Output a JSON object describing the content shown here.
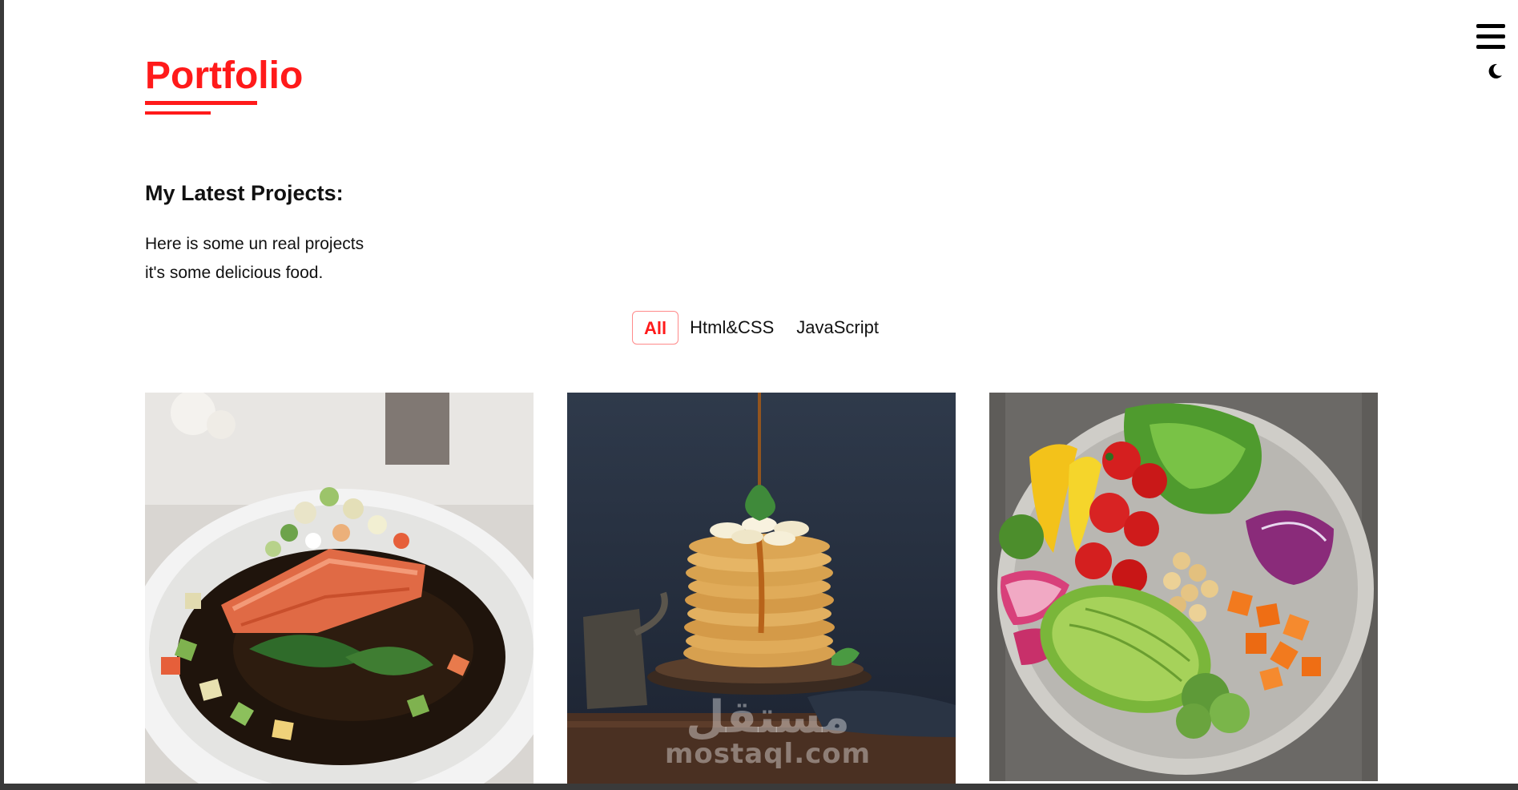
{
  "header": {
    "menu_icon": "hamburger-menu-icon",
    "theme_icon": "moon-icon"
  },
  "portfolio": {
    "title": "Portfolio",
    "subtitle": "My Latest Projects:",
    "description_line1": "Here is some un real projects",
    "description_line2": "it's some delicious food."
  },
  "filters": [
    {
      "label": "All",
      "active": true
    },
    {
      "label": "Html&CSS",
      "active": false
    },
    {
      "label": "JavaScript",
      "active": false
    }
  ],
  "projects": [
    {
      "image": "salmon-plate-photo"
    },
    {
      "image": "pancake-stack-photo"
    },
    {
      "image": "salad-bowl-photo"
    }
  ],
  "watermark": {
    "arabic": "مستقل",
    "latin": "mostaql.com"
  },
  "colors": {
    "accent": "#ff1a1a",
    "background": "#ffffff",
    "text": "#111111"
  }
}
